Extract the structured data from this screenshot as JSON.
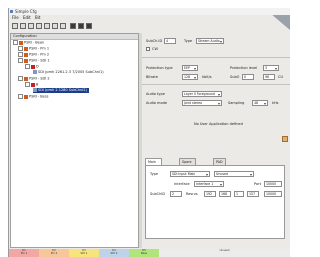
{
  "window": {
    "title": "Simple Cfg",
    "menus": [
      "File",
      "Edit",
      "Bit"
    ]
  },
  "toolbar": {
    "icons": [
      "new-icon",
      "open-icon",
      "save-icon",
      "copy-icon",
      "paste-icon",
      "delete-icon",
      "settings-icon",
      "grid-icon",
      "grid-alt-icon",
      "list-icon"
    ]
  },
  "tree": {
    "header": "Configuration",
    "nodes": [
      {
        "label": "PSRI - Bean",
        "level": 0,
        "icon": "module-icon"
      },
      {
        "label": "PSRI - Pm 1",
        "level": 1,
        "icon": "module-icon"
      },
      {
        "label": "PSRI - Pm 2",
        "level": 1,
        "icon": "module-icon"
      },
      {
        "label": "PSRI - SDI 1",
        "level": 1,
        "icon": "module-icon"
      },
      {
        "label": "D",
        "level": 2,
        "icon": "device-icon"
      },
      {
        "label": "SDI (pmh 2261.2.3 7/2005 SubChnl1)",
        "level": 3,
        "icon": "signal-icon"
      },
      {
        "label": "PSRI - SDI 2",
        "level": 1,
        "icon": "module-icon"
      },
      {
        "label": "B",
        "level": 2,
        "icon": "device-icon"
      },
      {
        "label": "SDI (pmh 2 1280 SubChnl2)",
        "level": 3,
        "icon": "signal-icon",
        "selected": true
      },
      {
        "label": "PSRI - Bess",
        "level": 1,
        "icon": "module-icon"
      }
    ]
  },
  "form": {
    "subch_label": "SubCh.ID",
    "subch_value": "4",
    "type_label": "Type",
    "type_value": "Stream Audio",
    "cw_label": "CW",
    "protection_type_label": "Protection type",
    "protection_type_value": "EEP",
    "protection_level_label": "Protection level",
    "protection_level_value": "3",
    "bitrate_label": "Bitrate",
    "bitrate_value": "128",
    "bitrate_unit": "kbit/s",
    "size_label": "SubO",
    "size_value": "0",
    "size_value2": "96",
    "size_unit": "CU",
    "audio_type_label": "Audio type",
    "audio_type_value": "Layer II Foreground",
    "audio_mode_label": "Audio mode",
    "audio_mode_value": "Joint stereo",
    "sampling_label": "Sampling",
    "sampling_value": "48",
    "sampling_unit": "kHz",
    "no_user_app_text": "No User Application defined"
  },
  "tabs": [
    {
      "label": "Main source",
      "active": true
    },
    {
      "label": "Spare source"
    },
    {
      "label": "PAD UDP"
    }
  ],
  "source": {
    "type_label": "Type",
    "type_value": "SDI Input Main",
    "type2_value": "Unused",
    "interface_label": "Interface",
    "interface_value": "Interface 1",
    "port_label": "Port",
    "port_value": "10000",
    "subch_label": "SubChID",
    "subch_value": "2",
    "reserve_label": "Resrvs",
    "ip": [
      "192",
      "168",
      "1",
      "157"
    ],
    "port2_value": "10000"
  },
  "status_bar": [
    {
      "top": "D1",
      "bottom": "Pm 1",
      "color": "#f1a7a3"
    },
    {
      "top": "D2",
      "bottom": "Pm 2",
      "color": "#f6c799"
    },
    {
      "top": "D3",
      "bottom": "SDI 1",
      "color": "#f7e57c"
    },
    {
      "top": "D4",
      "bottom": "SDI 2",
      "color": "#bcd3ea"
    },
    {
      "top": "D5",
      "bottom": "Bess",
      "color": "#b0e57c"
    },
    {
      "top": "",
      "bottom": "Unused",
      "color": "#ececec"
    }
  ]
}
